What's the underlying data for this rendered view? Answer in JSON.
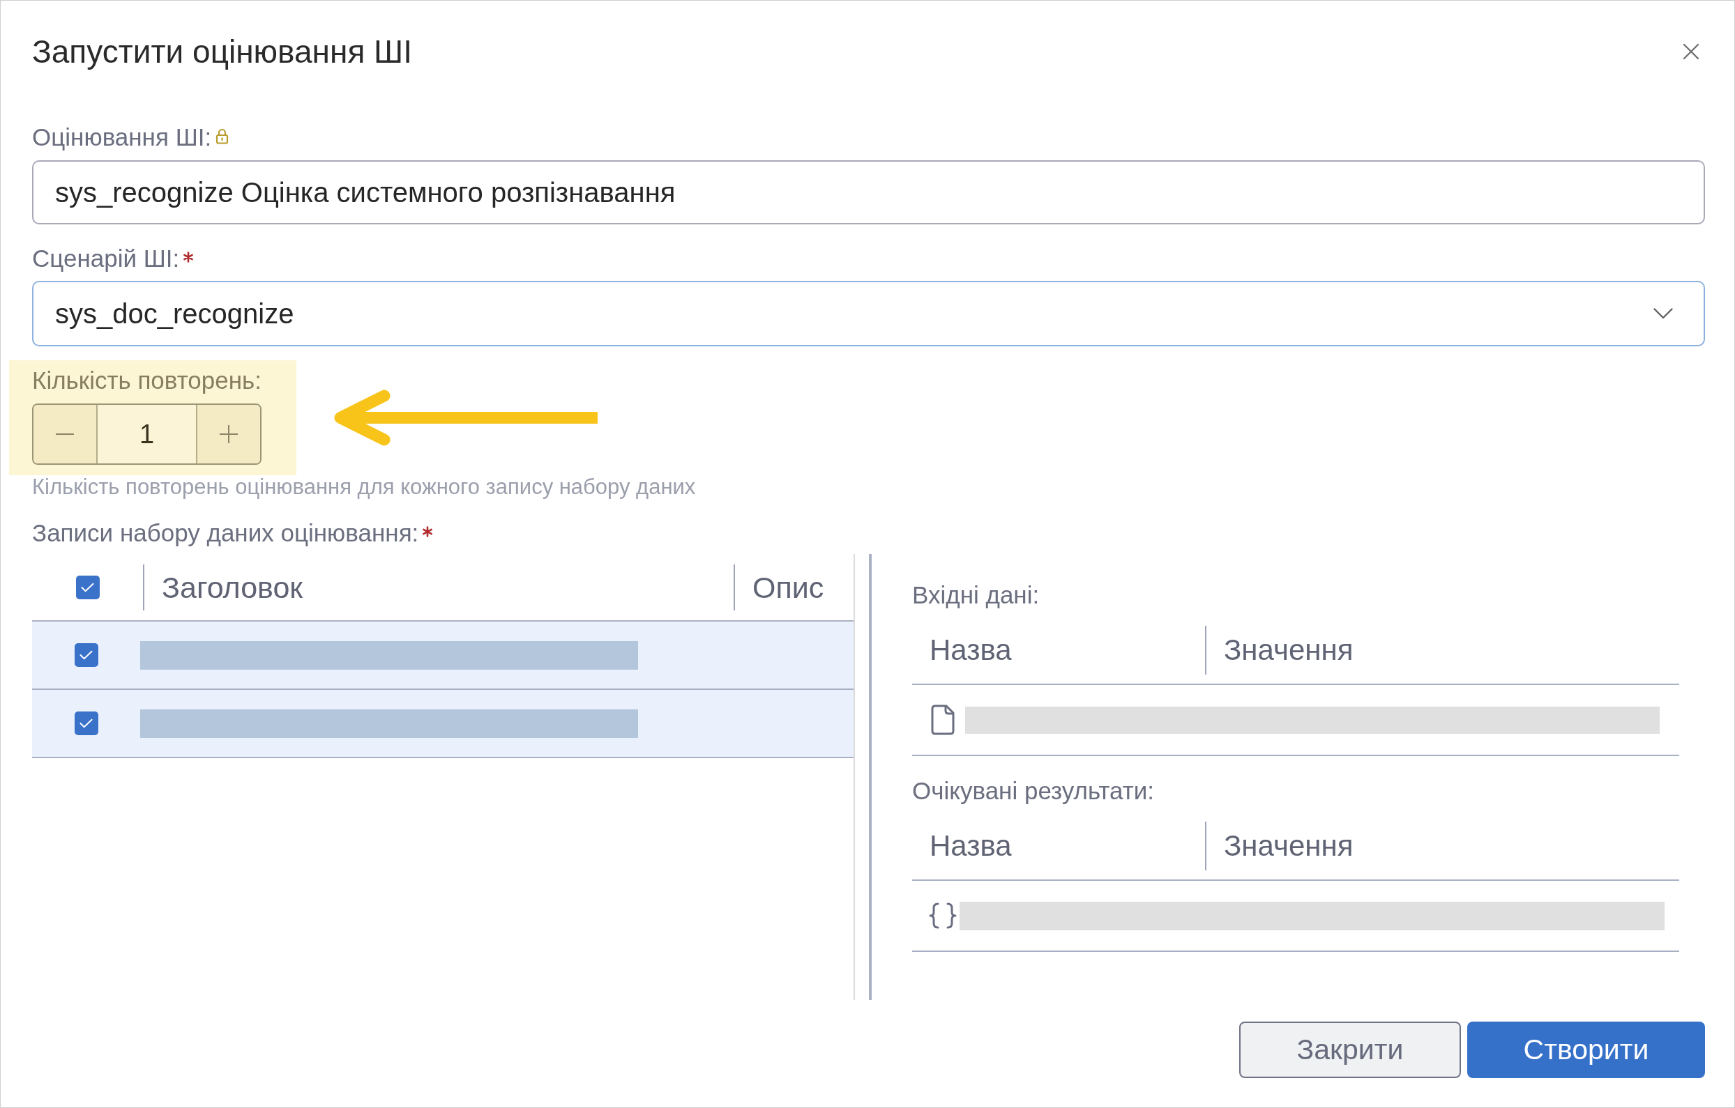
{
  "dialog": {
    "title": "Запустити оцінювання ШІ"
  },
  "evaluation": {
    "label": "Оцінювання ШІ:",
    "locked": true,
    "value": "sys_recognize Оцінка системного розпізнавання"
  },
  "scenario": {
    "label": "Сценарій ШІ:",
    "required": true,
    "value": "sys_doc_recognize"
  },
  "repeat_count": {
    "label": "Кількість повторень:",
    "value": "1",
    "highlighted": true,
    "hint": "Кількість повторень оцінювання для кожного запису набору даних"
  },
  "records": {
    "label": "Записи набору даних оцінювання:",
    "required": true,
    "select_all": {
      "checked": true
    },
    "columns": [
      "Заголовок",
      "Опис"
    ],
    "rows": [
      {
        "checked": true
      },
      {
        "checked": true
      }
    ]
  },
  "input_data": {
    "label": "Вхідні дані:",
    "columns": [
      "Назва",
      "Значення"
    ],
    "rows": [
      {
        "kind": "file"
      }
    ]
  },
  "expected_results": {
    "label": "Очікувані результати:",
    "columns": [
      "Назва",
      "Значення"
    ],
    "rows": [
      {
        "kind": "json"
      }
    ]
  },
  "buttons": [
    {
      "label": "Закрити",
      "kind": "secondary"
    },
    {
      "label": "Створити",
      "kind": "primary"
    }
  ]
}
